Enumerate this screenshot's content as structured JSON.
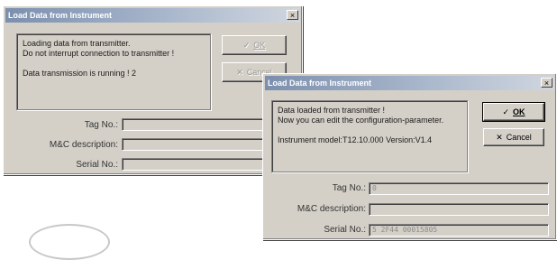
{
  "dialog1": {
    "title": "Load Data from Instrument",
    "close_glyph": "×",
    "messages": [
      "Loading data from transmitter.",
      "Do not interrupt connection to transmitter !",
      "",
      "Data transmission is running ! 2"
    ],
    "ok_label": "OK",
    "cancel_label": "Cancel",
    "tag_label": "Tag No.:",
    "mc_label": "M&C description:",
    "serial_label": "Serial No.:",
    "tag_value": "",
    "mc_value": "",
    "serial_value": ""
  },
  "dialog2": {
    "title": "Load Data from Instrument",
    "close_glyph": "×",
    "messages": [
      "Data loaded from transmitter !",
      "Now you can edit the configuration-parameter.",
      "",
      "Instrument model:T12.10.000    Version:V1.4"
    ],
    "ok_label": "OK",
    "cancel_label": "Cancel",
    "tag_label": "Tag No.:",
    "mc_label": "M&C description:",
    "serial_label": "Serial No.:",
    "tag_value": "0",
    "mc_value": "",
    "serial_value": "5 2F44 00015805"
  },
  "icons": {
    "ok": "check-icon",
    "cancel": "x-icon"
  }
}
